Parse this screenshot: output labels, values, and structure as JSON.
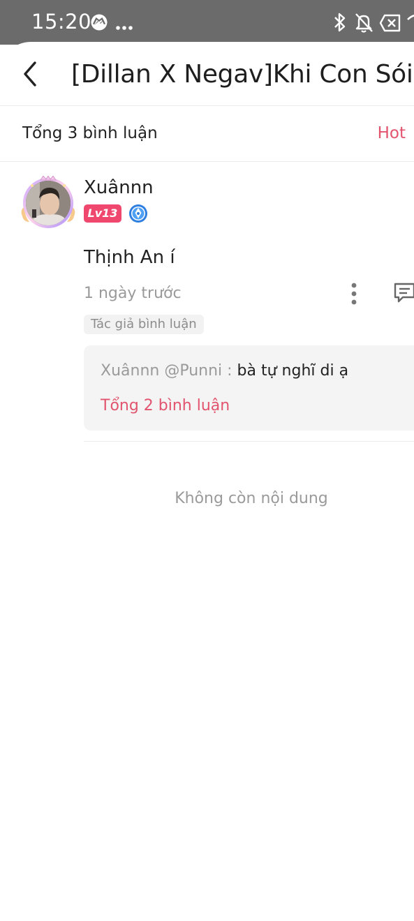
{
  "status_bar": {
    "time": "15:20",
    "icons": [
      "messenger-icon",
      "more-dots-icon",
      "bluetooth-icon",
      "bell-off-icon",
      "no-sim-icon",
      "wifi-icon"
    ]
  },
  "header": {
    "title": "[Dillan X Negav]Khi Con Sói Ch"
  },
  "comments_header": {
    "total": "Tổng 3 bình luận",
    "sort_label": "Hot"
  },
  "comment": {
    "username": "Xuânnn",
    "level": "Lv13",
    "text": "Thịnh An í",
    "time": "1 ngày trước",
    "author_tag": "Tác giả bình luận",
    "reply": {
      "user": "Xuânnn @Punni : ",
      "text": "bà tự nghĩ di ạ",
      "total": "Tổng 2 bình luận"
    }
  },
  "footer": {
    "end_message": "Không còn nội dung"
  },
  "colors": {
    "accent": "#e2546e",
    "level_badge": "#f0476e",
    "status_bar": "#6b6b6b"
  }
}
